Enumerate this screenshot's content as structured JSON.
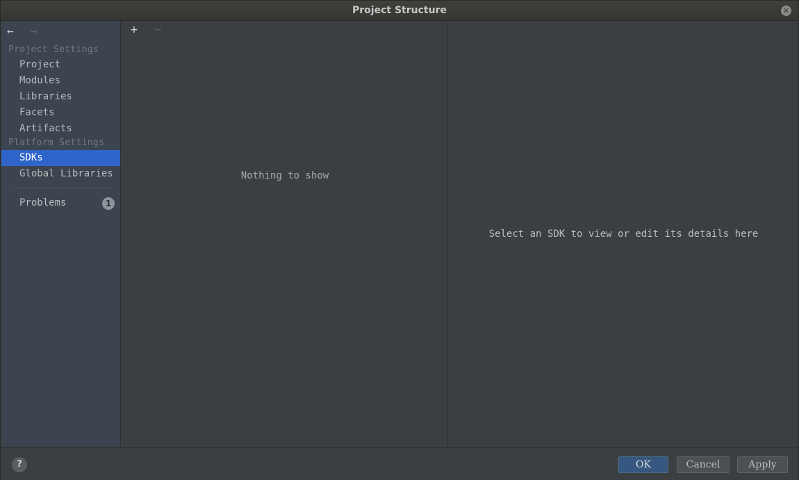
{
  "window": {
    "title": "Project Structure",
    "close_glyph": "✕"
  },
  "nav": {
    "back_glyph": "←",
    "forward_glyph": "→"
  },
  "sidebar": {
    "project_settings_header": "Project Settings",
    "project_items": [
      {
        "label": "Project"
      },
      {
        "label": "Modules"
      },
      {
        "label": "Libraries"
      },
      {
        "label": "Facets"
      },
      {
        "label": "Artifacts"
      }
    ],
    "platform_settings_header": "Platform Settings",
    "platform_items": [
      {
        "label": "SDKs",
        "selected": true
      },
      {
        "label": "Global Libraries"
      }
    ],
    "problems": {
      "label": "Problems",
      "count": "1"
    }
  },
  "list": {
    "add_glyph": "+",
    "remove_glyph": "−",
    "empty_text": "Nothing to show"
  },
  "detail": {
    "placeholder": "Select an SDK to view or edit its details here"
  },
  "footer": {
    "help_glyph": "?",
    "ok_label": "OK",
    "cancel_label": "Cancel",
    "apply_label": "Apply"
  },
  "colors": {
    "selection": "#2f65ca",
    "sidebar_bg": "#3c4450",
    "panel_bg": "#3c3f41",
    "primary_button": "#365880"
  }
}
